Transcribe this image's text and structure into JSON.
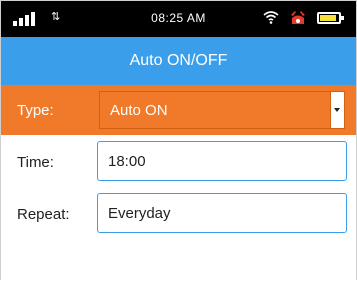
{
  "status_bar": {
    "time": "08:25 AM",
    "icons": [
      "signal-icon",
      "network-icon",
      "wifi-icon",
      "alarm-icon",
      "battery-icon"
    ],
    "colors": {
      "background": "#000000",
      "battery_fill": "#f5e23a",
      "alarm": "#e03b2b"
    }
  },
  "header": {
    "title": "Auto ON/OFF",
    "color": "#3a9eea"
  },
  "form": {
    "type": {
      "label": "Type:",
      "value": "Auto ON",
      "color": "#f07a2a"
    },
    "time": {
      "label": "Time:",
      "value": "18:00"
    },
    "repeat": {
      "label": "Repeat:",
      "value": "Everyday"
    }
  }
}
